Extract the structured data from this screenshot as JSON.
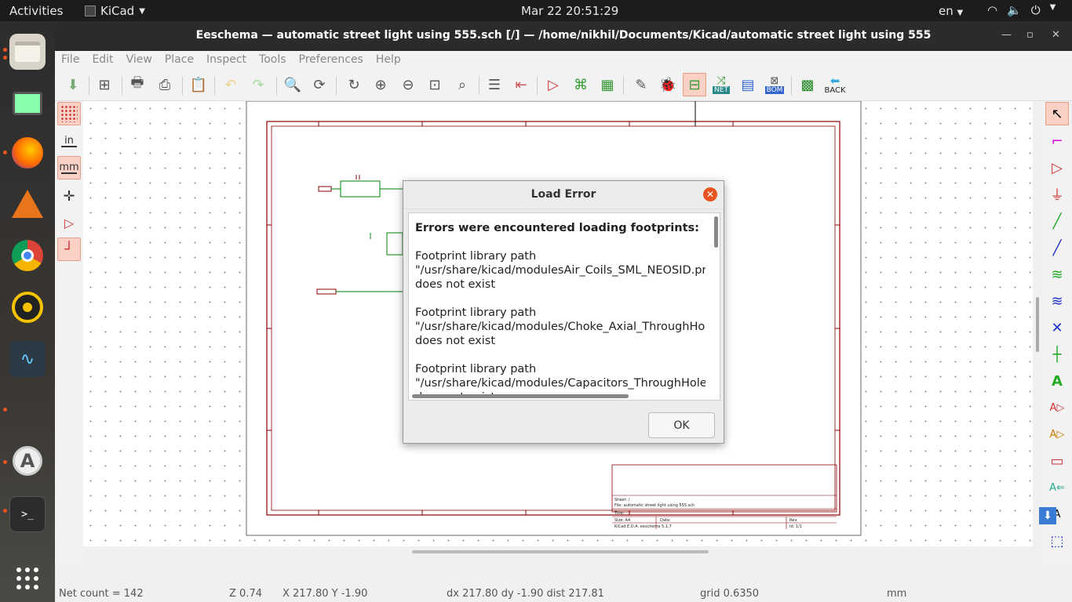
{
  "topbar": {
    "activities": "Activities",
    "app_name": "KiCad",
    "clock": "Mar 22  20:51:29",
    "lang": "en"
  },
  "window": {
    "title": "Eeschema — automatic street light using 555.sch [/] — /home/nikhil/Documents/Kicad/automatic street light using 555"
  },
  "menu": [
    "File",
    "Edit",
    "View",
    "Place",
    "Inspect",
    "Tools",
    "Preferences",
    "Help"
  ],
  "toolbar": {
    "back_label": "BACK",
    "net_label": "NET",
    "bom_label": "BOM"
  },
  "lefttools": {
    "in_label": "in",
    "mm_label": "mm"
  },
  "schematic": {
    "sheet_label": "Sheet: /",
    "file_label": "File: automatic street light using 555.sch",
    "title_label": "Title:",
    "size_label": "Size: A4",
    "date_label": "Date:",
    "rev_label": "Rev:",
    "kicad_label": "KiCad E.D.A.  eeschema 5.1.7",
    "id_label": "Id: 1/1"
  },
  "dialog": {
    "title": "Load Error",
    "header": "Errors were encountered loading footprints:",
    "entries": [
      {
        "line1": "Footprint library path",
        "line2": "\"/usr/share/kicad/modulesAir_Coils_SML_NEOSID.pre",
        "line3": "does not exist"
      },
      {
        "line1": "Footprint library path",
        "line2": "\"/usr/share/kicad/modules/Choke_Axial_ThroughHole",
        "line3": "does not exist"
      },
      {
        "line1": "Footprint library path",
        "line2": "\"/usr/share/kicad/modules/Capacitors_ThroughHole.",
        "line3": "does not exist"
      }
    ],
    "ok_label": "OK"
  },
  "status": {
    "net_count": "Net count = 142",
    "zoom": "Z 0.74",
    "xy": "X 217.80  Y -1.90",
    "delta": "dx 217.80  dy -1.90  dist 217.81",
    "grid": "grid 0.6350",
    "units": "mm"
  },
  "colors": {
    "accent": "#e95420",
    "schematic_border": "#8b0000",
    "wire": "#008000"
  }
}
